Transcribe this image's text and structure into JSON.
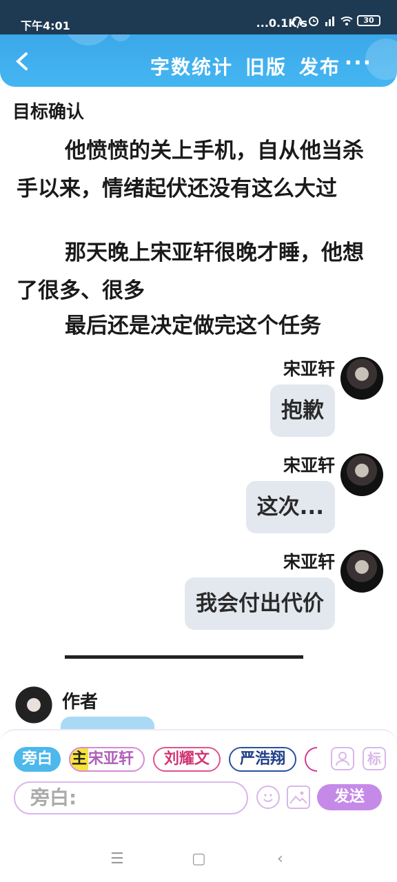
{
  "status_bar": {
    "time": "下午4:01",
    "network_speed": "...0.1K/s",
    "battery": "30"
  },
  "header": {
    "actions": [
      "字数统计",
      "旧版",
      "发布"
    ],
    "more": "···"
  },
  "chapter_title": "目标确认",
  "paragraphs": [
    "他愤愤的关上手机，自从他当杀手以来，情绪起伏还没有这么大过",
    "那天晚上宋亚轩很晚才睡，他想了很多、很多",
    "最后还是决定做完这个任务"
  ],
  "messages": [
    {
      "name": "宋亚轩",
      "text": "抱歉"
    },
    {
      "name": "宋亚轩",
      "text": "这次..."
    },
    {
      "name": "宋亚轩",
      "text": "我会付出代价"
    }
  ],
  "author": {
    "name": "作者"
  },
  "composer": {
    "chips": {
      "narration": "旁白",
      "main_mark": "主",
      "main_name": "宋亚轩",
      "char2": "刘耀文",
      "char3": "严浩翔"
    },
    "mark_label": "标",
    "input_placeholder": "旁白:",
    "send_label": "发送"
  },
  "colors": {
    "header_blue": "#3aa6e8",
    "send_purple": "#c58ae8",
    "bubble_grey": "#e3e8ef"
  }
}
